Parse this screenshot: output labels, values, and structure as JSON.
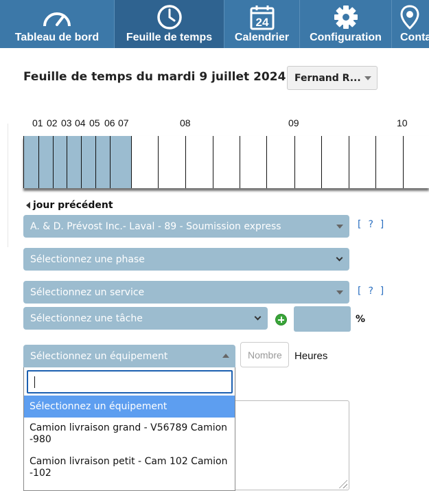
{
  "nav": {
    "items": [
      {
        "label": "Tableau de bord",
        "icon": "speedometer-icon"
      },
      {
        "label": "Feuille de temps",
        "icon": "clock-icon"
      },
      {
        "label": "Calendrier",
        "icon": "calendar-icon",
        "day": "24"
      },
      {
        "label": "Configuration",
        "icon": "gear-icon"
      },
      {
        "label": "Conta",
        "icon": "location-pin-icon"
      }
    ],
    "active": "Feuille de temps"
  },
  "header": {
    "title": "Feuille de temps du mardi 9 juillet 2024 -",
    "user": "Fernand R..."
  },
  "timeline": {
    "hour_labels": [
      "01",
      "02",
      "03",
      "04",
      "05",
      "06",
      "07",
      "08",
      "09",
      "10"
    ],
    "filled_until_hour": "07"
  },
  "form": {
    "prev_day": "jour précédent",
    "project": "A. & D. Prévost Inc.- Laval - 89 - Soumission express",
    "phase": "Sélectionnez une phase",
    "service": "Sélectionnez un service",
    "task": "Sélectionnez une tâche",
    "help": "[ ? ]",
    "percent_label": "%",
    "equipment": "Sélectionnez un équipement",
    "number_placeholder": "Nombre",
    "hours_label": "Heures"
  },
  "dropdown": {
    "search_value": "",
    "options": [
      "Sélectionnez un équipement",
      "Camion livraison grand - V56789 Camion -980",
      "Camion livraison petit - Cam 102 Camion -102"
    ],
    "selected": "Sélectionnez un équipement"
  },
  "colors": {
    "nav_bg": "#3c78a8",
    "nav_active": "#2f6390",
    "select_bg": "#9cbccf",
    "option_highlight": "#5d9ef0",
    "link": "#2a6fc0"
  }
}
